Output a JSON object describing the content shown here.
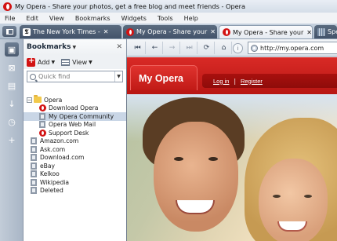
{
  "window": {
    "title": "My Opera - Share your photos, get a free blog and meet friends - Opera"
  },
  "menu": [
    "File",
    "Edit",
    "View",
    "Bookmarks",
    "Widgets",
    "Tools",
    "Help"
  ],
  "tabs": [
    {
      "label": "The New York Times -",
      "icon": "nyt-icon",
      "active": false
    },
    {
      "label": "My Opera - Share your",
      "icon": "opera-icon",
      "active": false
    },
    {
      "label": "My Opera - Share your",
      "icon": "opera-icon",
      "active": true
    },
    {
      "label": "Spe",
      "icon": "speed-dial-icon",
      "active": false
    }
  ],
  "bookmarks_panel": {
    "title": "Bookmarks",
    "add_label": "Add",
    "view_label": "View",
    "search_placeholder": "Quick find",
    "tree": {
      "folder": "Opera",
      "children": [
        "Download Opera",
        "My Opera Community",
        "Opera Web Mail",
        "Support Desk"
      ],
      "selected": "My Opera Community",
      "items": [
        "Amazon.com",
        "Ask.com",
        "Download.com",
        "eBay",
        "Kelkoo",
        "Wikipedia",
        "Deleted"
      ]
    }
  },
  "address_bar": {
    "url": "http://my.opera.com"
  },
  "page": {
    "logo": "My Opera",
    "login": "Log in",
    "register": "Register",
    "separator": "|"
  },
  "colors": {
    "opera_red": "#d21313",
    "header_red": "#c51d19",
    "selection": "#c9d6e6"
  }
}
